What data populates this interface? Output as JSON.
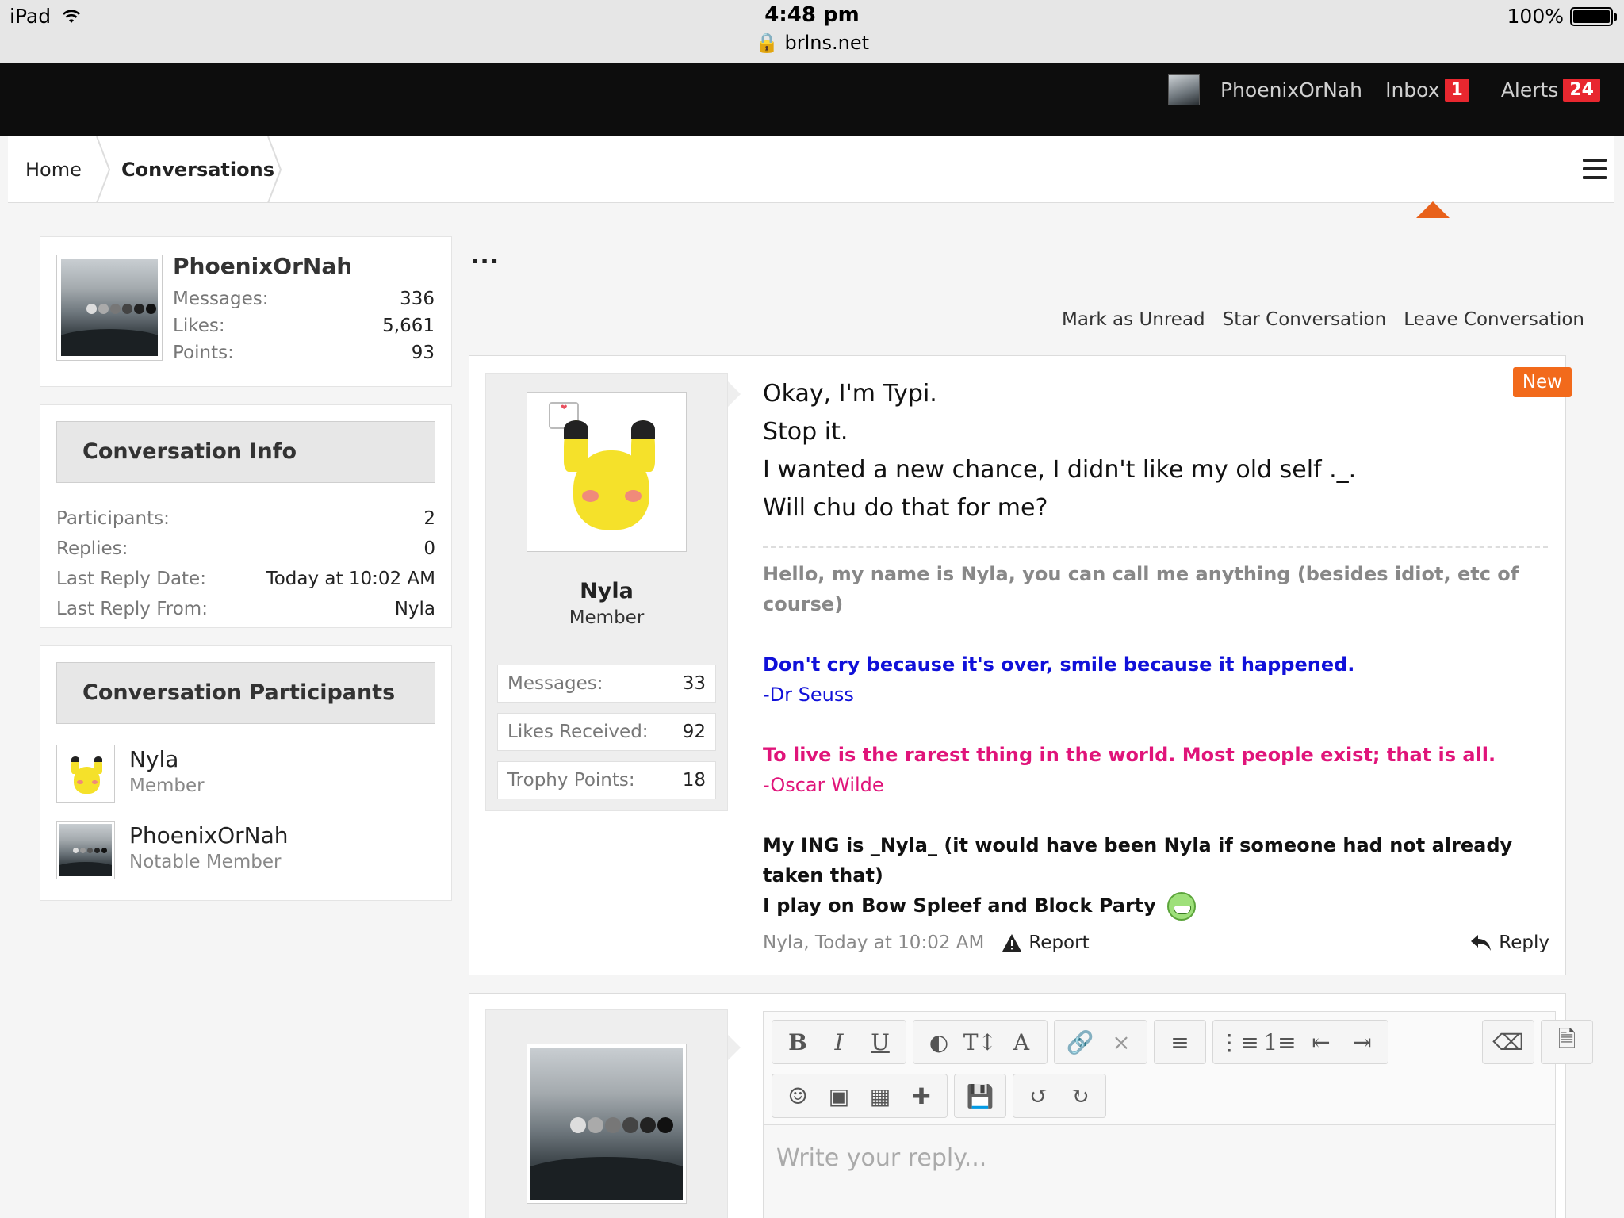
{
  "status_bar": {
    "device": "iPad",
    "time": "4:48 pm",
    "url": "brlns.net",
    "battery": "100%"
  },
  "top_nav": {
    "username": "PhoenixOrNah",
    "inbox_label": "Inbox",
    "inbox_count": "1",
    "alerts_label": "Alerts",
    "alerts_count": "24"
  },
  "breadcrumb": {
    "home": "Home",
    "current": "Conversations"
  },
  "sidebar": {
    "profile": {
      "name": "PhoenixOrNah",
      "stats": [
        {
          "label": "Messages:",
          "value": "336"
        },
        {
          "label": "Likes:",
          "value": "5,661"
        },
        {
          "label": "Points:",
          "value": "93"
        }
      ]
    },
    "info": {
      "title": "Conversation Info",
      "rows": [
        {
          "label": "Participants:",
          "value": "2"
        },
        {
          "label": "Replies:",
          "value": "0"
        },
        {
          "label": "Last Reply Date:",
          "value": "Today at 10:02 AM"
        },
        {
          "label": "Last Reply From:",
          "value": "Nyla"
        }
      ]
    },
    "participants": {
      "title": "Conversation Participants",
      "items": [
        {
          "name": "Nyla",
          "role": "Member"
        },
        {
          "name": "PhoenixOrNah",
          "role": "Notable Member"
        }
      ]
    }
  },
  "main": {
    "menu": "...",
    "actions": [
      "Mark as Unread",
      "Star Conversation",
      "Leave Conversation"
    ],
    "message": {
      "author": "Nyla",
      "role": "Member",
      "badge": "New",
      "stats": [
        {
          "label": "Messages:",
          "value": "33"
        },
        {
          "label": "Likes Received:",
          "value": "92"
        },
        {
          "label": "Trophy Points:",
          "value": "18"
        }
      ],
      "lines": [
        "Okay, I'm Typi.",
        "Stop it.",
        "I wanted a new chance, I didn't like my old self ._.",
        "Will chu do that for me?"
      ],
      "signature": {
        "intro": "Hello, my name is Nyla, you can call me anything (besides idiot, etc of course)",
        "quote1": "Don't cry because it's over, smile because it happened.",
        "quote1_author": "-Dr Seuss",
        "quote2": "To live is the rarest thing in the world. Most people exist; that is all.",
        "quote2_author": "-Oscar Wilde",
        "ing": "My ING is _Nyla_ (it would have been Nyla if someone had not already taken that)",
        "play": "I play on Bow Spleef and Block Party"
      },
      "footer": {
        "meta": "Nyla, Today at 10:02 AM",
        "report": "Report",
        "reply": "Reply"
      }
    },
    "reply_editor": {
      "placeholder": "Write your reply..."
    }
  },
  "colors": {
    "accent_orange": "#f26a1b",
    "badge_red": "#e8272f",
    "quote_blue": "#1010d9",
    "quote_pink": "#e0147a"
  }
}
